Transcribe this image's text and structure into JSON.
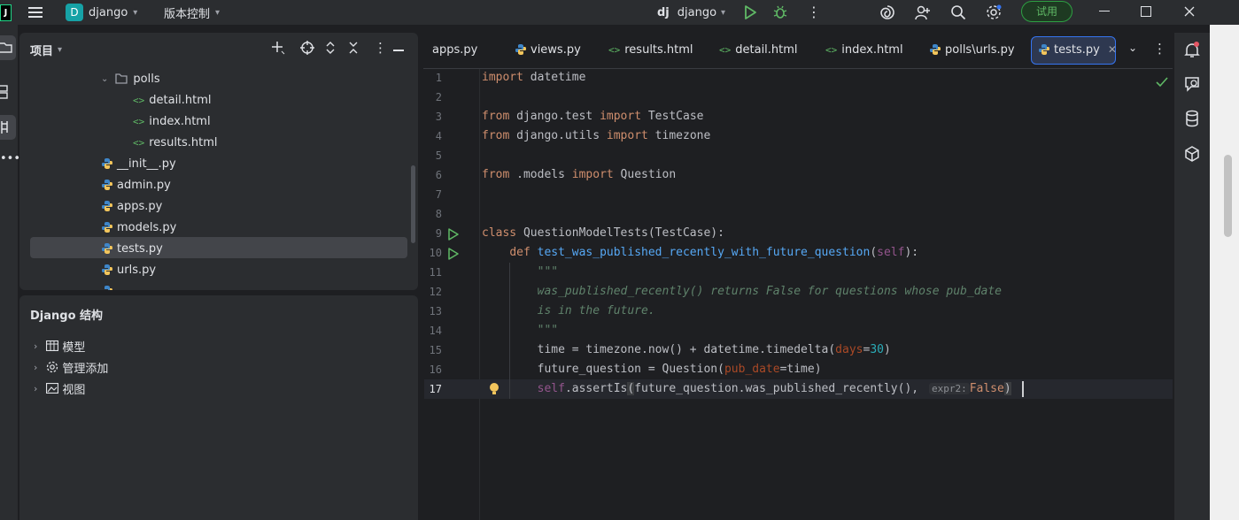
{
  "titlebar": {
    "app_icon_letter": "J",
    "project_badge": "D",
    "project_name": "django",
    "vcs_label": "版本控制",
    "run_config_prefix": "dj",
    "run_config_name": "django",
    "trial_button": "试用",
    "accent": "#2ea043"
  },
  "project_panel": {
    "title": "项目",
    "tree": [
      {
        "label": "polls",
        "type": "folder"
      },
      {
        "label": "detail.html",
        "type": "html"
      },
      {
        "label": "index.html",
        "type": "html"
      },
      {
        "label": "results.html",
        "type": "html"
      },
      {
        "label": "__init__.py",
        "type": "py"
      },
      {
        "label": "admin.py",
        "type": "py"
      },
      {
        "label": "apps.py",
        "type": "py"
      },
      {
        "label": "models.py",
        "type": "py"
      },
      {
        "label": "tests.py",
        "type": "py",
        "selected": true
      },
      {
        "label": "urls.py",
        "type": "py"
      }
    ]
  },
  "django_panel": {
    "title": "Django 结构",
    "items": [
      {
        "label": "模型",
        "icon": "table-icon"
      },
      {
        "label": "管理添加",
        "icon": "gear-icon"
      },
      {
        "label": "视图",
        "icon": "image-icon"
      }
    ]
  },
  "tabs": [
    {
      "label": "apps.py",
      "type": "py"
    },
    {
      "label": "views.py",
      "type": "py"
    },
    {
      "label": "results.html",
      "type": "html"
    },
    {
      "label": "detail.html",
      "type": "html"
    },
    {
      "label": "index.html",
      "type": "html"
    },
    {
      "label": "polls\\urls.py",
      "type": "py"
    },
    {
      "label": "tests.py",
      "type": "py",
      "active": true
    }
  ],
  "editor": {
    "line_numbers": [
      "1",
      "2",
      "3",
      "4",
      "5",
      "6",
      "7",
      "8",
      "9",
      "10",
      "11",
      "12",
      "13",
      "14",
      "15",
      "16",
      "17"
    ],
    "inlay_hint": "expr2:"
  }
}
